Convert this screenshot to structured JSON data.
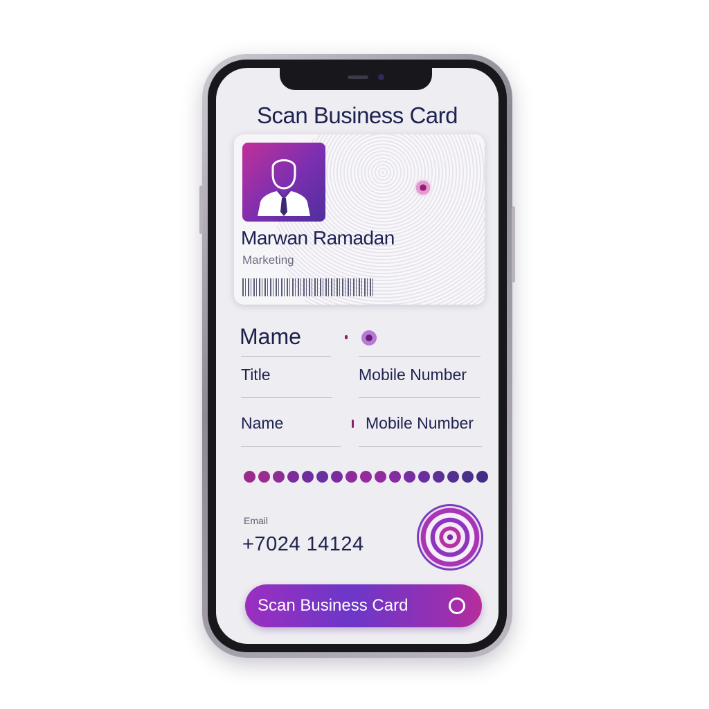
{
  "header": {
    "title": "Scan Business Card"
  },
  "business_card": {
    "name": "Marwan Ramadan",
    "role": "Marketing"
  },
  "form": {
    "heading": "Mame",
    "row1": {
      "left_label": "Title",
      "right_label": "Mobile Number"
    },
    "row2": {
      "left_label": "Name",
      "right_label": "Mobile Number"
    }
  },
  "contact": {
    "email_label": "Email",
    "phone": "+7024 14124"
  },
  "progress_dot_colors": [
    "#9a2a8e",
    "#9c2c92",
    "#8f2d97",
    "#7e2c9a",
    "#6d2d9e",
    "#6a2fa1",
    "#7c2aa0",
    "#8d2a9e",
    "#972a9d",
    "#922aa0",
    "#852ca2",
    "#772ea1",
    "#6a2f9e",
    "#5e2f98",
    "#52308f",
    "#49308a",
    "#412e84"
  ],
  "actions": {
    "scan_button_label": "Scan Business Card",
    "fingerprint_icon": "fingerprint-icon",
    "scan_ring_icon": "ring-icon"
  },
  "colors": {
    "accent": "#7b2fbf",
    "accent_pink": "#b82d9a",
    "text_dark": "#1e2250",
    "screen_bg": "#eeedf1"
  }
}
